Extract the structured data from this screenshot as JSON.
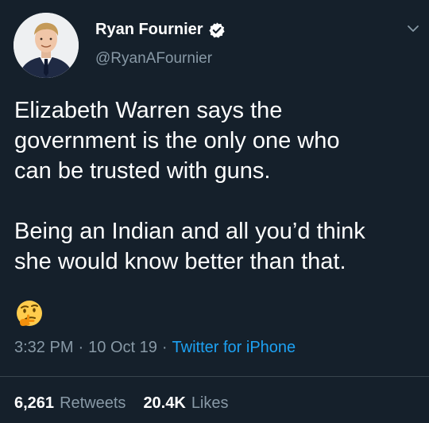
{
  "author": {
    "display_name": "Ryan Fournier",
    "handle": "@RyanAFournier",
    "verified": true,
    "avatar_icon": "profile-photo"
  },
  "tweet": {
    "text": "Elizabeth Warren says the\ngovernment is the only one who\ncan be trusted with guns.\n\nBeing an Indian and all you’d think\nshe would know better than that.",
    "emoji": "thinking-face-icon",
    "time": "3:32 PM",
    "date": "10 Oct 19",
    "separator": "·",
    "source": "Twitter for iPhone"
  },
  "stats": {
    "retweets_count": "6,261",
    "retweets_label": "Retweets",
    "likes_count": "20.4K",
    "likes_label": "Likes"
  },
  "colors": {
    "background": "#15202b",
    "text": "#ffffff",
    "muted": "#8899a6",
    "accent": "#1da1f2",
    "divider": "#38444d"
  }
}
